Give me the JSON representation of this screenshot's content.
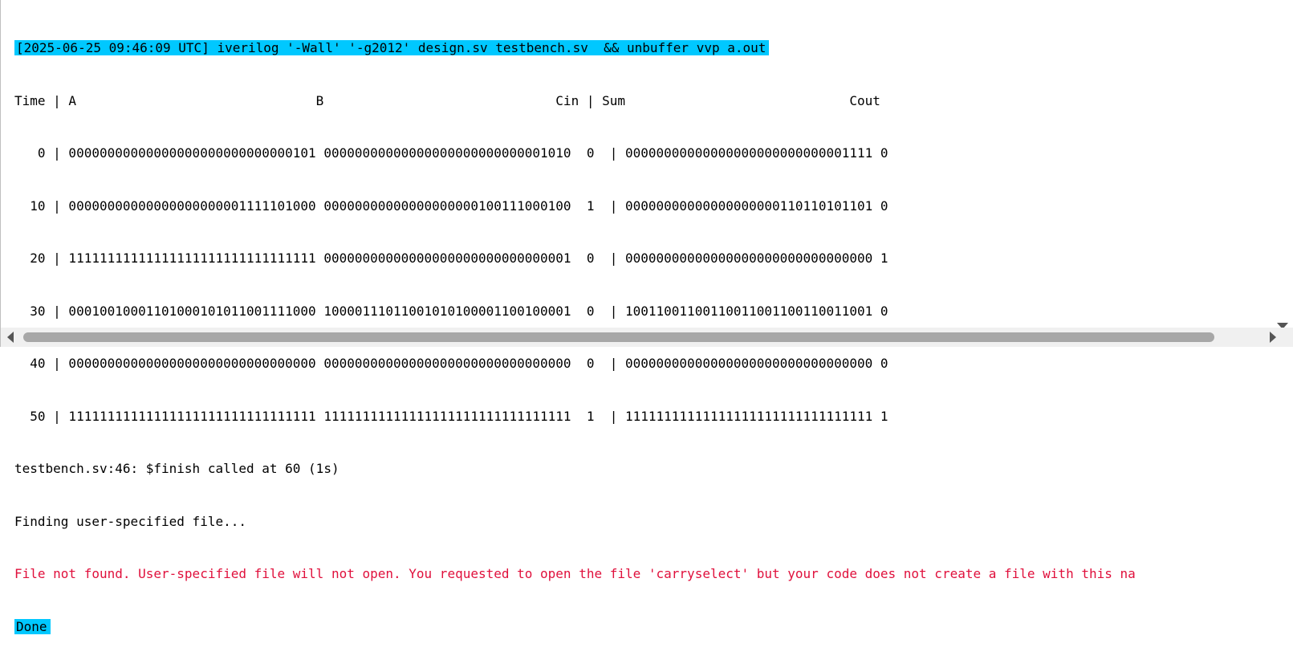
{
  "console": {
    "command": "[2025-06-25 09:46:09 UTC] iverilog '-Wall' '-g2012' design.sv testbench.sv  && unbuffer vvp a.out",
    "header": "Time | A                               B                              Cin | Sum                             Cout",
    "rows": [
      "   0 | 00000000000000000000000000000101 00000000000000000000000000001010  0  | 00000000000000000000000000001111 0",
      "  10 | 00000000000000000000001111101000 00000000000000000000100111000100  1  | 00000000000000000000110110101101 0",
      "  20 | 11111111111111111111111111111111 00000000000000000000000000000001  0  | 00000000000000000000000000000000 1",
      "  30 | 00010010001101000101011001111000 10000111011001010100001100100001  0  | 10011001100110011001100110011001 0",
      "  40 | 00000000000000000000000000000000 00000000000000000000000000000000  0  | 00000000000000000000000000000000 0",
      "  50 | 11111111111111111111111111111111 11111111111111111111111111111111  1  | 11111111111111111111111111111111 1"
    ],
    "finish_msg": "testbench.sv:46: $finish called at 60 (1s)",
    "finding_msg": "Finding user-specified file...",
    "error_msg": "File not found. User-specified file will not open. You requested to open the file 'carryselect' but your code does not create a file with this na",
    "done_label": "Done"
  },
  "colors": {
    "highlight": "#00c8ff",
    "error": "#e0103c",
    "scrollbar_thumb": "#a7a7a7"
  },
  "icons": {
    "scroll_down": "chevron-down-icon",
    "scroll_left": "chevron-left-icon",
    "scroll_right": "chevron-right-icon"
  }
}
